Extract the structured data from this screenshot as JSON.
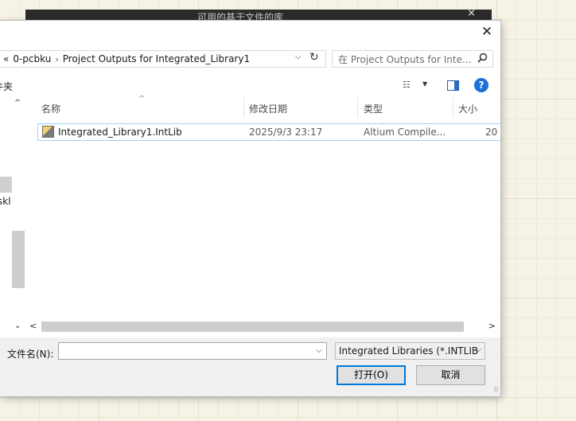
{
  "background_window": {
    "title": "可用的基于文件的库",
    "close_label": "×"
  },
  "dialog": {
    "close_label": "✕",
    "address_bar": {
      "overflow": "«",
      "segments": [
        "0-pcbku",
        "Project Outputs for Integrated_Library1"
      ],
      "separator": "›",
      "dropdown": "⌵",
      "refresh": "↻"
    },
    "search": {
      "placeholder": "在 Project Outputs for Inte...",
      "icon": "search-icon"
    },
    "toolbar": {
      "clipped_label": "件夹",
      "view_icon": "☷",
      "view_dropdown": "▼",
      "help_label": "?"
    },
    "nav_pane": {
      "up": "^",
      "down": "⌄",
      "clipped_item": "skl"
    },
    "columns": {
      "name": "名称",
      "date": "修改日期",
      "type": "类型",
      "size": "大小",
      "sort_indicator": "^"
    },
    "files": [
      {
        "name": "Integrated_Library1.IntLib",
        "date": "2025/9/3 23:17",
        "type": "Altium Compile...",
        "size": "20"
      }
    ],
    "hscroll": {
      "left": "<",
      "right": ">"
    },
    "filename_label": "文件名(N):",
    "filename_value": "",
    "filename_dropdown": "⌵",
    "filter": {
      "value": "Integrated Libraries (*.INTLIB",
      "dropdown": "⌵"
    },
    "open_button": "打开(O)",
    "cancel_button": "取消",
    "grip": "⠿"
  }
}
